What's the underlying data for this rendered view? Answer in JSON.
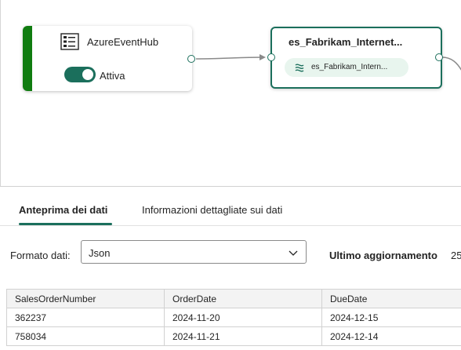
{
  "canvas": {
    "source_node": {
      "title": "AzureEventHub",
      "icon": "event-hub-icon",
      "toggle_label": "Attiva",
      "status_color": "#107c10"
    },
    "stream_node": {
      "title": "es_Fabrikam_Internet...",
      "chip_label": "es_Fabrikam_Intern...",
      "accent_color": "#1b6f5c"
    }
  },
  "panel": {
    "tabs": [
      {
        "label": "Anteprima dei dati",
        "active": true
      },
      {
        "label": "Informazioni dettagliate sui dati",
        "active": false
      }
    ],
    "format_label": "Formato dati:",
    "format_value": "Json",
    "last_update_label": "Ultimo aggiornamento",
    "last_update_value": "25"
  },
  "table": {
    "columns": [
      "SalesOrderNumber",
      "OrderDate",
      "DueDate"
    ],
    "rows": [
      [
        "362237",
        "2024-11-20",
        "2024-12-15"
      ],
      [
        "758034",
        "2024-11-21",
        "2024-12-14"
      ]
    ]
  }
}
